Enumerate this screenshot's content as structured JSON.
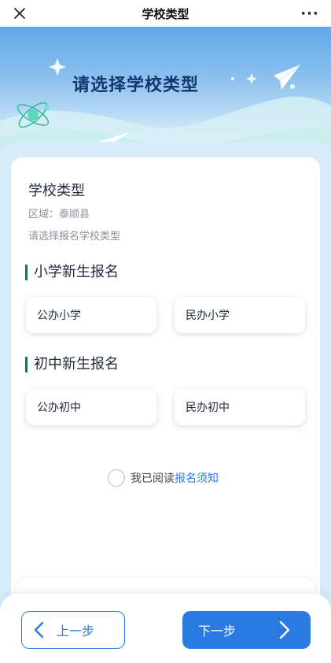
{
  "navbar": {
    "title": "学校类型",
    "close_icon": "close-icon",
    "more_label": "···"
  },
  "hero": {
    "title": "请选择学校类型"
  },
  "card": {
    "title": "学校类型",
    "region": "区域：泰顺县",
    "hint": "请选择报名学校类型"
  },
  "sections": [
    {
      "title": "小学新生报名",
      "options": [
        "公办小学",
        "民办小学"
      ]
    },
    {
      "title": "初中新生报名",
      "options": [
        "公办初中",
        "民办初中"
      ]
    }
  ],
  "agreement": {
    "prefix": "我已阅读",
    "link": "报名须知"
  },
  "footer": {
    "prev_label": "上一步",
    "next_label": "下一步"
  },
  "colors": {
    "accent": "#2a7ae2",
    "section_bar": "#1f6f5c",
    "frame": "#d6ecfa"
  }
}
